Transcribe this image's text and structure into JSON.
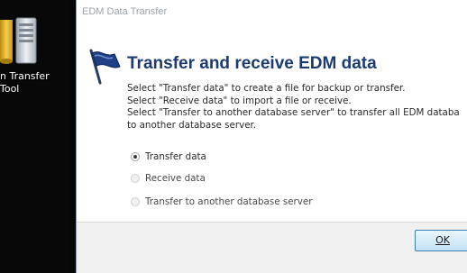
{
  "desktop": {
    "icon_name": "database-icon",
    "icon_label": "n Transfer\nTool"
  },
  "dialog": {
    "title": "EDM Data Transfer",
    "flag_icon": "flag-icon",
    "heading": "Transfer and receive EDM data",
    "description": [
      "Select \"Transfer data\" to create a file for backup or transfer.",
      "Select \"Receive data\" to import a file or receive.",
      "Select \"Transfer to another database server\" to transfer all EDM databa",
      "to another database server."
    ],
    "options": [
      {
        "label": "Transfer data",
        "selected": true
      },
      {
        "label": "Receive data",
        "selected": false
      },
      {
        "label": "Transfer to another database server",
        "selected": false
      }
    ],
    "ok_label": "OK"
  },
  "colors": {
    "heading": "#1c3b70",
    "title_text": "#9aa2ab",
    "button_border": "#3c7fb1"
  }
}
